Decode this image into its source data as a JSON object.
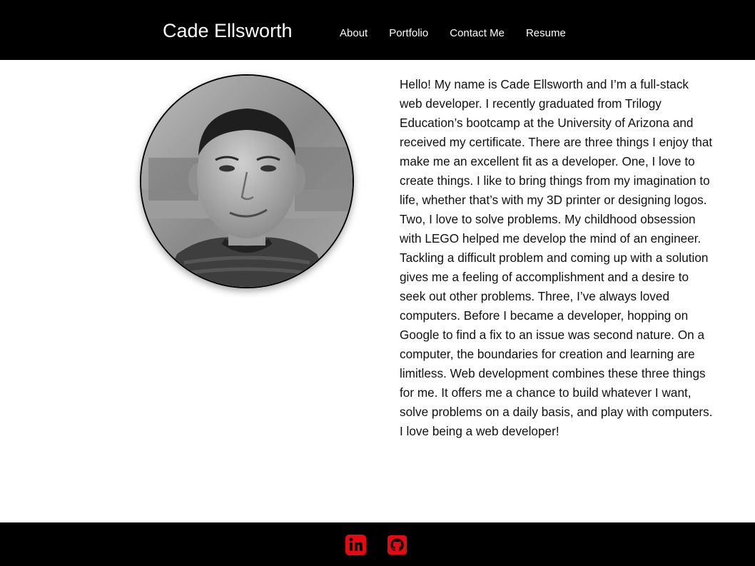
{
  "header": {
    "brand": "Cade Ellsworth",
    "nav": [
      {
        "label": "About"
      },
      {
        "label": "Portfolio"
      },
      {
        "label": "Contact Me"
      },
      {
        "label": "Resume"
      }
    ]
  },
  "about": {
    "photo_icon": "profile-photo",
    "bio": "Hello! My name is Cade Ellsworth and I’m a full-stack web developer. I recently graduated from Trilogy Education’s bootcamp at the University of Arizona and received my certificate. There are three things I enjoy that make me an excellent fit as a developer. One, I love to create things. I like to bring things from my imagination to life, whether that’s with my 3D printer or designing logos. Two, I love to solve problems. My childhood obsession with LEGO helped me develop the mind of an engineer. Tackling a difficult problem and coming up with a solution gives me a feeling of accomplishment and a desire to seek out other problems. Three, I’ve always loved computers. Before I became a developer, hopping on Google to find a fix to an issue was second nature. On a computer, the boundaries for creation and learning are limitless. Web development combines these three things for me. It offers me a chance to build whatever I want, solve problems on a daily basis, and play with computers. I love being a web developer!"
  },
  "footer": {
    "icons": [
      "linkedin-icon",
      "github-icon"
    ]
  },
  "colors": {
    "nav_background": "#000000",
    "nav_text": "#ffffff",
    "icon_accent": "#e50914",
    "body_background": "#ffffff"
  }
}
